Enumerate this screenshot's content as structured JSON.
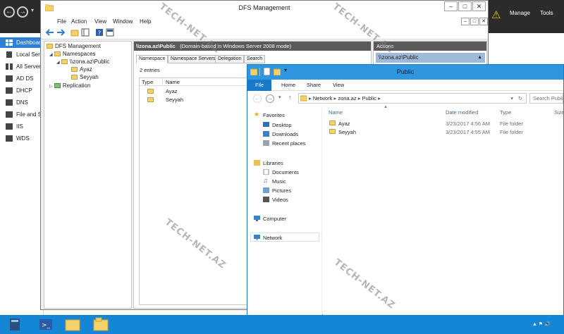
{
  "server_manager": {
    "header": {
      "manage_label": "Manage",
      "tools_label": "Tools"
    },
    "sidebar": [
      {
        "label": "Dashboard",
        "active": true
      },
      {
        "label": "Local Server"
      },
      {
        "label": "All Servers"
      },
      {
        "label": "AD DS"
      },
      {
        "label": "DHCP"
      },
      {
        "label": "DNS"
      },
      {
        "label": "File and Storage Services"
      },
      {
        "label": "IIS"
      },
      {
        "label": "WDS"
      }
    ]
  },
  "dfs": {
    "title": "DFS Management",
    "menu": [
      "File",
      "Action",
      "View",
      "Window",
      "Help"
    ],
    "tree": {
      "root": "DFS Management",
      "namespaces": "Namespaces",
      "namespace": "\\\\zona.az\\Public",
      "children": [
        "Ayaz",
        "Seyyah"
      ],
      "replication": "Replication"
    },
    "path_header": "\\\\zona.az\\Public",
    "path_note": "(Domain-based in Windows Server 2008 mode)",
    "tabs": [
      "Namespace",
      "Namespace Servers",
      "Delegation",
      "Search"
    ],
    "entries_count": "2 entries",
    "columns": [
      "Type",
      "Name"
    ],
    "rows": [
      "Ayaz",
      "Seyyah"
    ],
    "actions_header": "Actions",
    "actions_item": "\\\\zona.az\\Public"
  },
  "explorer": {
    "title": "Public",
    "ribbon_tabs": [
      "File",
      "Home",
      "Share",
      "View"
    ],
    "breadcrumb": [
      "Network",
      "zona.az",
      "Public"
    ],
    "search_placeholder": "Search Public",
    "nav": {
      "favorites": "Favorites",
      "favorites_items": [
        "Desktop",
        "Downloads",
        "Recent places"
      ],
      "libraries": "Libraries",
      "libraries_items": [
        "Documents",
        "Music",
        "Pictures",
        "Videos"
      ],
      "computer": "Computer",
      "network": "Network"
    },
    "columns": {
      "name": "Name",
      "date": "Date modified",
      "type": "Type",
      "size": "Size"
    },
    "files": [
      {
        "name": "Ayaz",
        "date": "3/23/2017 4:56 AM",
        "type": "File folder"
      },
      {
        "name": "Seyyah",
        "date": "3/23/2017 4:55 AM",
        "type": "File folder"
      }
    ]
  },
  "watermark": "TECH-NET.AZ",
  "colors": {
    "accent": "#2e7fd8",
    "taskbar": "#1586d6",
    "explorer_title": "#2f97e0"
  }
}
